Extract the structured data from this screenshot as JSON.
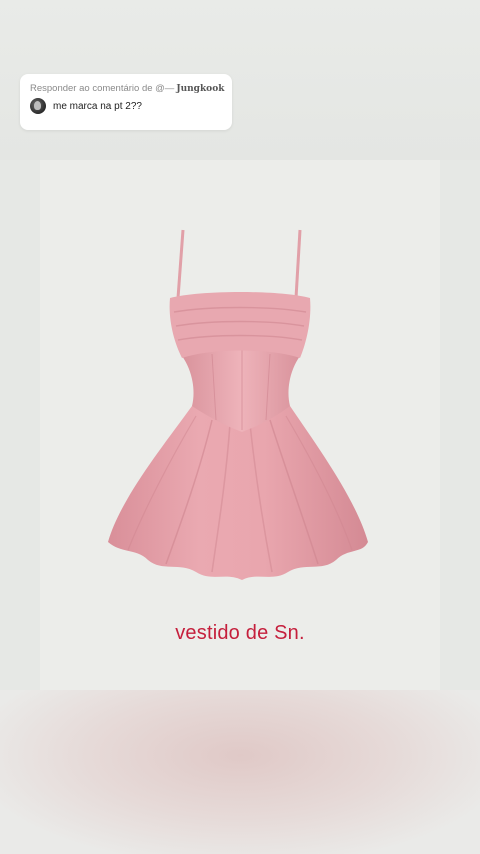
{
  "reply": {
    "prefix": "Responder ao comentário de @— ",
    "username": "Jungkook",
    "comment": "me marca na pt 2??"
  },
  "product": {
    "image_icon": "pink-dress-icon",
    "caption": "vestido de Sn."
  },
  "colors": {
    "caption": "#c51f3c",
    "dress": "#e7a3ac",
    "background": "#e6e8e5"
  }
}
